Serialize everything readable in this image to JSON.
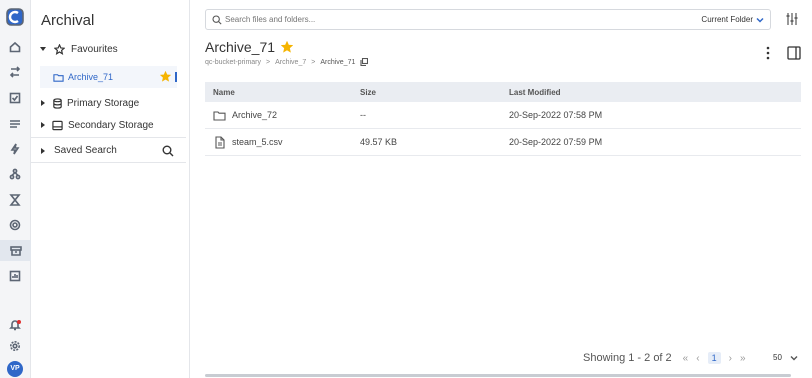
{
  "rail": {
    "items": [
      "home-icon",
      "connections-icon",
      "tasks-icon",
      "list-icon",
      "bolt-icon",
      "network-icon",
      "transform-icon",
      "gear-cog-icon",
      "archive-icon",
      "report-icon"
    ],
    "active": "archive-icon",
    "avatar": "VP"
  },
  "sidebar": {
    "title": "Archival",
    "favourites_label": "Favourites",
    "favourite_item": "Archive_71",
    "primary_label": "Primary Storage",
    "secondary_label": "Secondary Storage",
    "saved_search_label": "Saved Search"
  },
  "search": {
    "placeholder": "Search files and folders...",
    "scope": "Current Folder"
  },
  "folder": {
    "title": "Archive_71",
    "crumbs": [
      "qc-bucket-primary",
      "Archive_7",
      "Archive_71"
    ]
  },
  "table": {
    "headers": [
      "Name",
      "Size",
      "Last Modified"
    ],
    "rows": [
      {
        "icon": "folder-icon",
        "name": "Archive_72",
        "size": "--",
        "modified": "20-Sep-2022 07:58 PM"
      },
      {
        "icon": "file-icon",
        "name": "steam_5.csv",
        "size": "49.57 KB",
        "modified": "20-Sep-2022 07:59 PM"
      }
    ]
  },
  "pager": {
    "showing": "Showing 1 - 2 of 2",
    "page": "1",
    "per_page": "50"
  },
  "colors": {
    "accent": "#2f67c8",
    "star": "#f5b400",
    "header_bg": "#eaedf2"
  }
}
